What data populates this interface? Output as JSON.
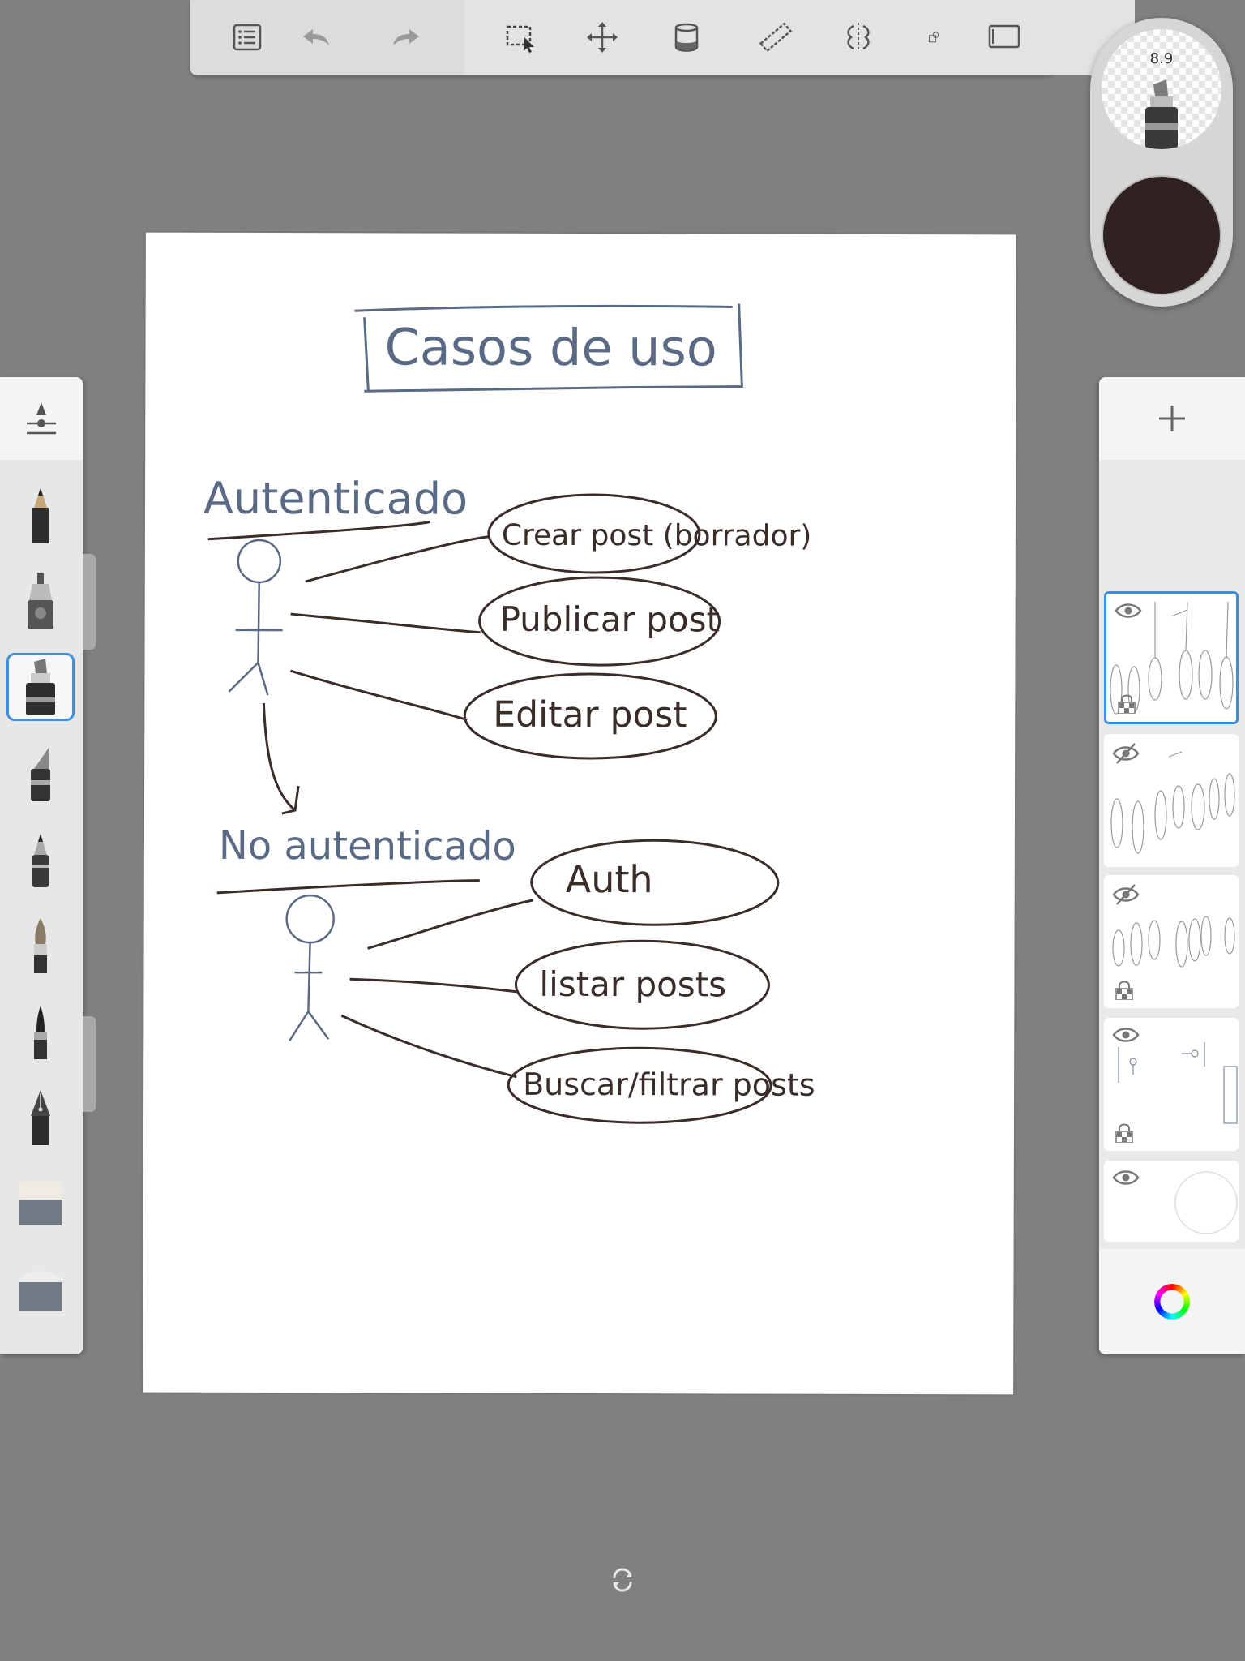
{
  "toolbar": {
    "buttons": [
      "list-icon",
      "undo-icon",
      "redo-icon",
      "selection-icon",
      "transform-icon",
      "fill-icon",
      "ruler-icon",
      "symmetry-icon",
      "shape-icon",
      "fullscreen-icon"
    ]
  },
  "puck": {
    "brush_size": "8.9",
    "color": "#302220"
  },
  "brushes": [
    "pencil",
    "inking-pen",
    "marker",
    "chisel-marker",
    "ballpoint",
    "paintbrush",
    "fine-brush",
    "fountain-pen",
    "soft-eraser",
    "hard-eraser"
  ],
  "selected_brush": "marker",
  "canvas": {
    "title": "Casos de uso",
    "actors": [
      {
        "label": "Autenticado",
        "use_cases": [
          "Crear post (borrador)",
          "Publicar post",
          "Editar post"
        ]
      },
      {
        "label": "No autenticado",
        "use_cases": [
          "Auth",
          "listar posts",
          "Buscar/filtrar posts"
        ]
      }
    ],
    "ink_blue": "#5a6a84",
    "ink_brown": "#3a2c28"
  },
  "layers": [
    {
      "visible": true,
      "locked": true,
      "active": true
    },
    {
      "visible": false,
      "locked": false,
      "active": false
    },
    {
      "visible": false,
      "locked": true,
      "active": false
    },
    {
      "visible": true,
      "locked": true,
      "active": false
    },
    {
      "visible": true,
      "locked": false,
      "active": false
    }
  ],
  "colors": {
    "selection": "#3d8fe0"
  }
}
